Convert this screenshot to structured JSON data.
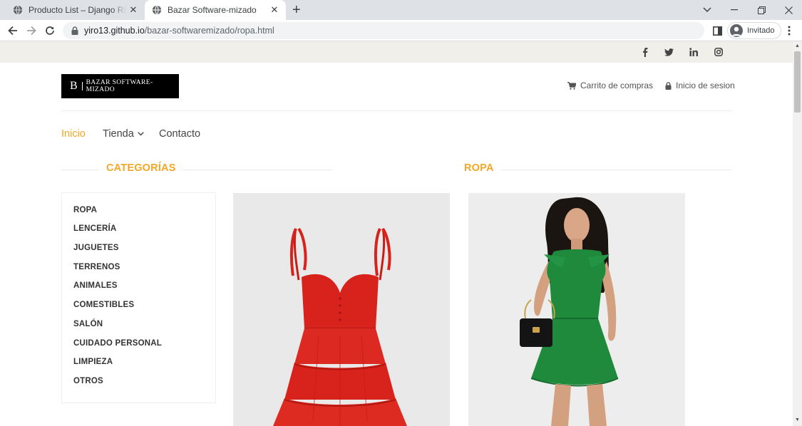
{
  "browser": {
    "tabs": [
      {
        "title": "Producto List – Django REST framework",
        "active": false
      },
      {
        "title": "Bazar Software-mizado",
        "active": true
      }
    ],
    "url_host": "yiro13.github.io",
    "url_path": "/bazar-softwaremizado/ropa.html",
    "profile_label": "Invitado"
  },
  "site": {
    "logo_mark": "B",
    "logo_text": "BAZAR SOFTWARE-MIZADO",
    "cart_label": "Carrito de compras",
    "login_label": "Inicio de sesion",
    "social": [
      "facebook-icon",
      "twitter-icon",
      "linkedin-icon",
      "instagram-icon"
    ],
    "nav": [
      {
        "label": "Inicio",
        "active": true
      },
      {
        "label": "Tienda",
        "dropdown": true
      },
      {
        "label": "Contacto"
      }
    ],
    "categories_title": "CATEGORÍAS",
    "section_title": "ROPA",
    "categories": [
      "ROPA",
      "LENCERÍA",
      "JUGUETES",
      "TERRENOS",
      "ANIMALES",
      "COMESTIBLES",
      "SALÓN",
      "CUIDADO PERSONAL",
      "LIMPIEZA",
      "OTROS"
    ],
    "products": [
      {
        "name": "red-dress",
        "color": "#d8231c"
      },
      {
        "name": "green-dress",
        "color": "#1f8a3c"
      }
    ],
    "accent": "#f5a623"
  }
}
